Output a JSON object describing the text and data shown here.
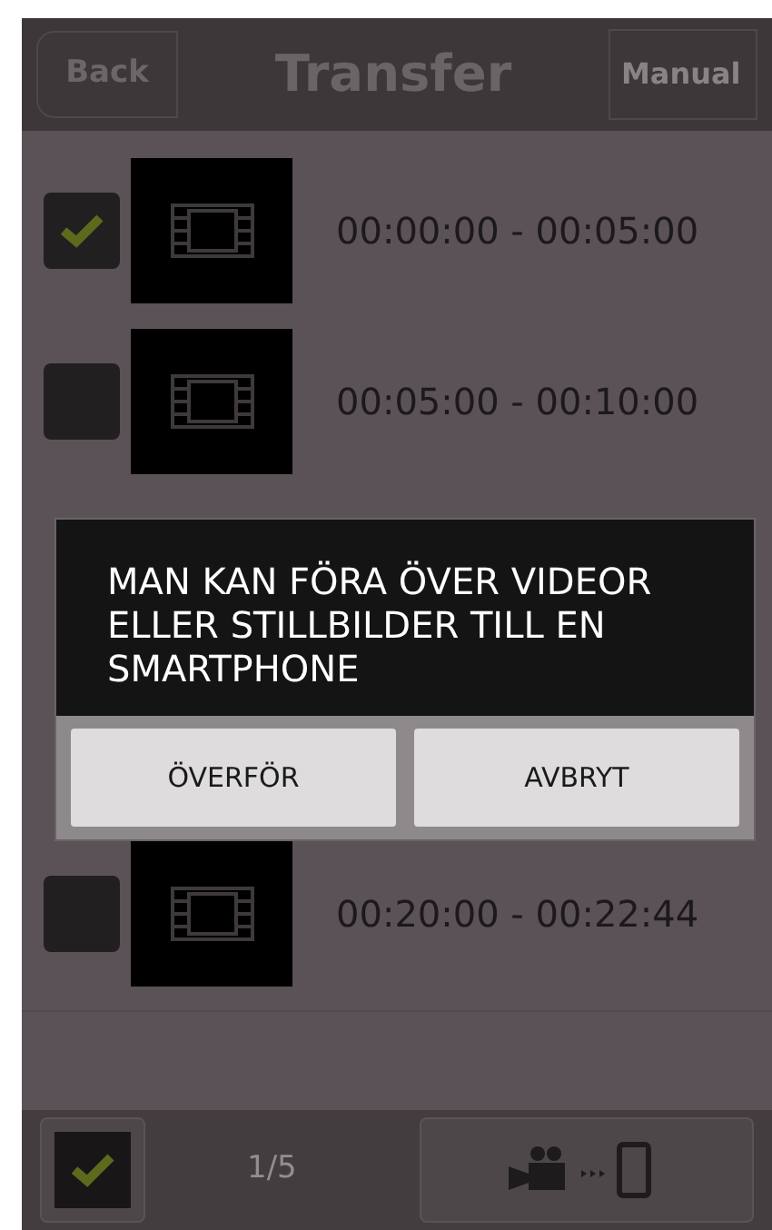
{
  "header": {
    "back": "Back",
    "title": "Transfer",
    "manual": "Manual"
  },
  "rows": [
    {
      "checked": true,
      "time": "00:00:00 - 00:05:00"
    },
    {
      "checked": false,
      "time": "00:05:00 - 00:10:00"
    },
    {
      "covered": true
    },
    {
      "covered": true
    },
    {
      "checked": false,
      "time": "00:20:00 - 00:22:44"
    }
  ],
  "footer": {
    "select_all_checked": true,
    "page": "1/5"
  },
  "dialog": {
    "message": "MAN KAN FÖRA ÖVER VIDEOR ELLER STILLBILDER TILL EN SMARTPHONE",
    "buttons": [
      "ÖVERFÖR",
      "AVBRYT"
    ]
  }
}
